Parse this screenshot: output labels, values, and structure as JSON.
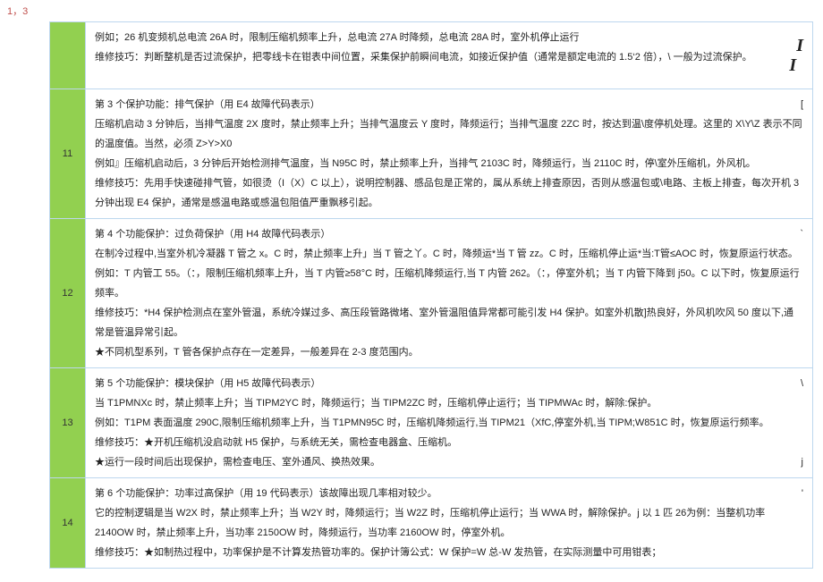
{
  "header_label": "1，3",
  "rows": [
    {
      "num": "",
      "lines": [
        "例如；26 机变频机总电流 26A 时，限制压缩机频率上升，总电流 27A 时降频，总电流 28A 时，室外机停止运行",
        "维修技巧：判断整机是否过流保护，把零线卡在钳表中间位置，采集保护前瞬间电流，如接近保护值（通常是额定电流的 1.5‘2 倍），\\ 一般为过流保护。"
      ],
      "side_glyph": "I",
      "side_glyph2": "I"
    },
    {
      "num": "11",
      "lines": [
        "第 3 个保护功能：排气保护（用 E4 故障代码表示）",
        "    压缩机启动 3 分钟后，当排气温度 2X 度时，禁止频率上升；当排气温度云 Y 度时，降频运行；当排气温度 2ZC 时，按达到温\\度停机处理。这里的 X\\Y\\Z 表示不同的温度值。当然，必须 Z>Y>X0",
        "例如』压缩机启动后，3 分钟后开始检测排气温度，当 N95C 时，禁止频率上升，当排气 2103C 时，降频运行，当 2110C 时，停\\室外压缩机，外风机。",
        "维修技巧：先用手快速碰排气管，如很烫（I（X）C 以上），说明控制器、感品包是正常的，属从系统上排查原因，否则从感温包或\\电路、主板上排查，每次开机 3 分钟出现 E4 保护，通常是感温电路或感温包阻值严重飘移引起。"
      ],
      "side_glyph": "["
    },
    {
      "num": "12",
      "lines": [
        "第 4 个功能保护：过负荷保护（用 H4 故障代码表示）",
        "在制冷过程中,当室外机冷凝器 T 管之 x。C 时，禁止频率上升」当 T 管之丫。C 时，降频运*当 T 管 zz。C 时，压缩机停止运*当:T管≤AOC 时，恢复原运行状态。",
        "例如：T 内管工 55。（：，限制压缩机频率上升，当 T 内管≥58°C 时，压缩机降频运行,当 T 内管 262。（：，停室外机；当 T 内管下降到 j50。C 以下时，恢复原运行频率。",
        "维修技巧：*H4 保护检测点在室外管温，系统冷媒过多、高压段管路微堵、室外管温阻值异常都可能引发 H4 保护。如室外机散]热良好，外风机吹风 50 度以下,通常是管温异常引起。",
        "★不同机型系列，T 管各保护点存在一定差异，一般差异在 2-3 度范围内。"
      ],
      "side_glyph": "`"
    },
    {
      "num": "13",
      "lines": [
        "",
        "第 5 个功能保护：模块保护（用 H5 故障代码表示）",
        "当 T1PMNXc 时，禁止频率上升；当 TIPM2YC 时，降频运行；当 TIPM2ZC 时，压缩机停止运行；当 TIPMWAc 时，解除:保护。",
        "例如：T1PM 表面温度 290C,限制压缩机频率上升，当 T1PMN95C 时，压缩机降频运行,当 TIPM21（XfC,停室外机,当 TIPM;W851C 时，恢复原运行频率。",
        "维修技巧：★开机压缩机没启动就 H5 保护，与系统无关，需检查电器盒、压缩机。",
        "★运行一段时间后出现保护，需检查电压、室外通风、换热效果。"
      ],
      "side_glyph": "\\",
      "bottom_glyph": "j"
    },
    {
      "num": "14",
      "lines": [
        "第 6 个功能保护：功率过高保护（用 19 代码表示）该故障出现几率相对较少。",
        "它的控制逻辑是当 W2X 时，禁止频率上升；当 W2Y 时，降频运行；当 W2Z 时，压缩机停止运行；当 WWA 时，解除保护。j 以 1 匹 26为例：当整机功率 2140OW 时，禁止频率上升，当功率 2150OW 时，降频运行，当功率 2160OW 时，停室外机。",
        "维修技巧：★如制热过程中，功率保护是不计算发热管功率的。保护计簿公式：W 保护=W 总-W 发热管，在实际测量中可用钳表；"
      ],
      "side_glyph": "'"
    }
  ]
}
